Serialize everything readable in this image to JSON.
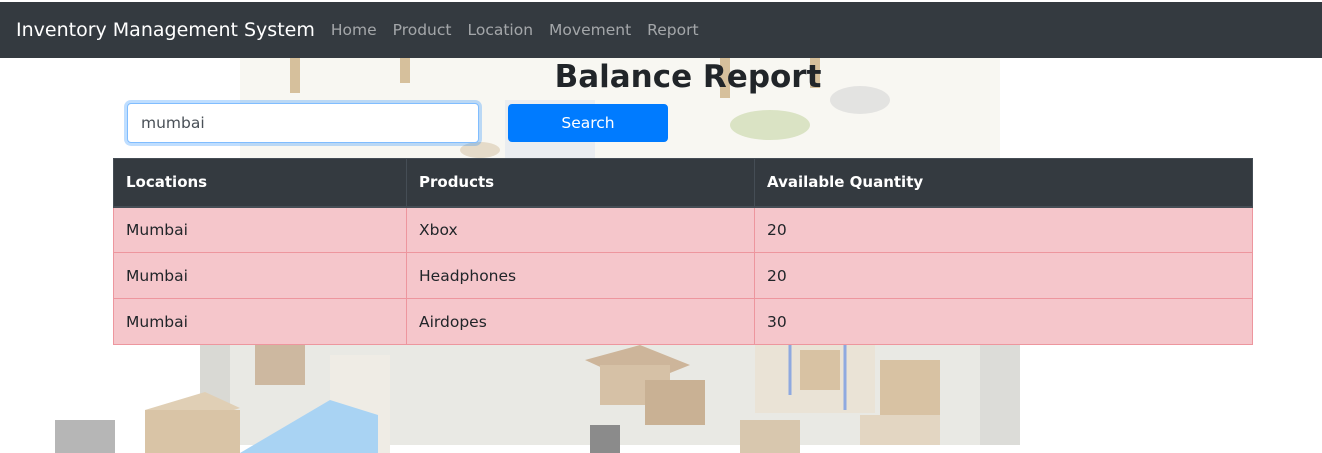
{
  "navbar": {
    "brand": "Inventory Management System",
    "links": [
      {
        "label": "Home"
      },
      {
        "label": "Product"
      },
      {
        "label": "Location"
      },
      {
        "label": "Movement"
      },
      {
        "label": "Report"
      }
    ]
  },
  "page": {
    "title": "Balance Report"
  },
  "search": {
    "value": "mumbai",
    "button_label": "Search"
  },
  "table": {
    "headers": [
      "Locations",
      "Products",
      "Available Quantity"
    ],
    "rows": [
      [
        "Mumbai",
        "Xbox",
        "20"
      ],
      [
        "Mumbai",
        "Headphones",
        "20"
      ],
      [
        "Mumbai",
        "Airdopes",
        "30"
      ]
    ]
  },
  "colors": {
    "navbar": "#343a40",
    "primary": "#007bff",
    "row_danger": "#f5c6cb"
  }
}
